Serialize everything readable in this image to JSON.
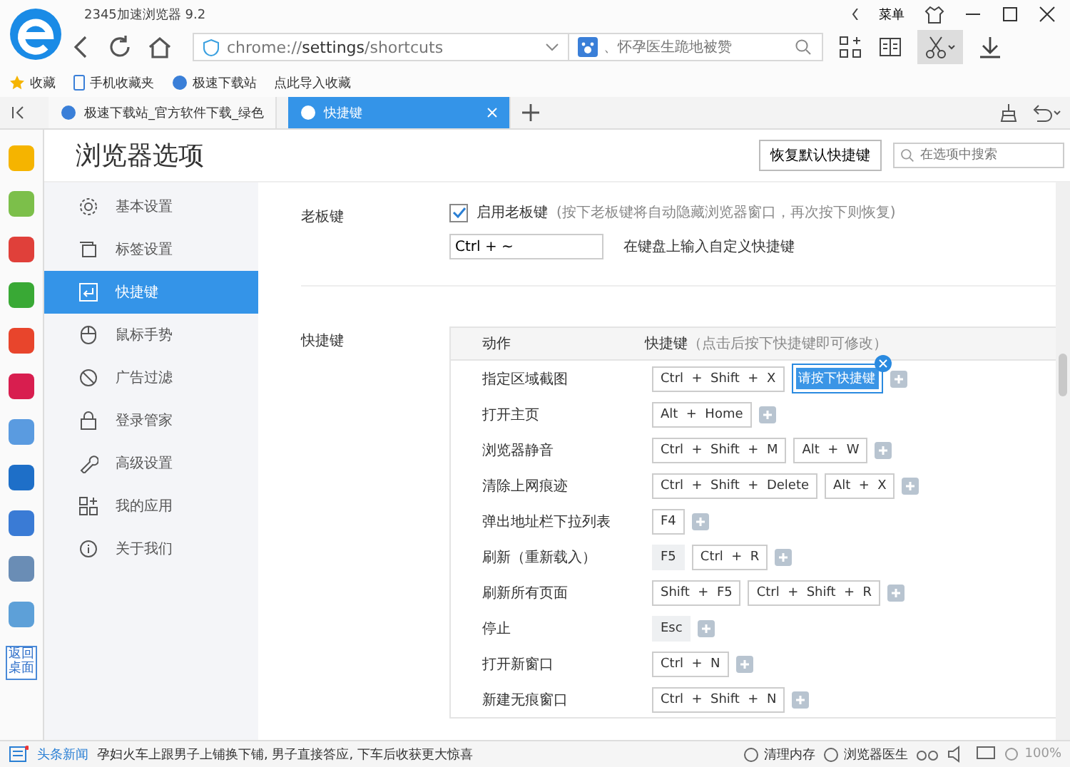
{
  "window": {
    "title": "2345加速浏览器 9.2",
    "menu": "菜单"
  },
  "address_bar": {
    "url": "chrome://**settings**/shortcuts",
    "search_placeholder": "、怀孕医生跪地被赞"
  },
  "bookmarks": [
    "收藏",
    "手机收藏夹",
    "极速下载站",
    "点此导入收藏"
  ],
  "tabs": [
    {
      "label": "极速下载站_官方软件下载_绿色",
      "selected": false
    },
    {
      "label": "快捷键",
      "selected": true
    }
  ],
  "side_panel": {
    "desktop_button": "返回桌面"
  },
  "page": {
    "title": "浏览器选项",
    "reset_button": "恢复默认快捷键",
    "search_placeholder": "在选项中搜索"
  },
  "nav": [
    {
      "label": "基本设置",
      "kind": "gear",
      "selected": false
    },
    {
      "label": "标签设置",
      "kind": "tabs",
      "selected": false
    },
    {
      "label": "快捷键",
      "kind": "enter",
      "selected": true
    },
    {
      "label": "鼠标手势",
      "kind": "mouse",
      "selected": false
    },
    {
      "label": "广告过滤",
      "kind": "block",
      "selected": false
    },
    {
      "label": "登录管家",
      "kind": "lock",
      "selected": false
    },
    {
      "label": "高级设置",
      "kind": "wrench",
      "selected": false
    },
    {
      "label": "我的应用",
      "kind": "apps",
      "selected": false
    },
    {
      "label": "关于我们",
      "kind": "info",
      "selected": false
    }
  ],
  "boss_key": {
    "label": "老板键",
    "checkbox_label": "启用老板键",
    "checked": true,
    "hint": "(按下老板键将自动隐藏浏览器窗口，再次按下则恢复)",
    "value": "Ctrl + ~",
    "note": "在键盘上输入自定义快捷键"
  },
  "shortcuts": {
    "label": "快捷键",
    "columns": [
      "动作",
      "快捷键"
    ],
    "column_hint": "（点击后按下快捷键即可修改）",
    "rows": [
      {
        "action": "指定区域截图",
        "keys": [
          {
            "text": "Ctrl  +  Shift  +  X",
            "kind": "editable"
          },
          {
            "text": "请按下快捷键",
            "kind": "recording"
          }
        ]
      },
      {
        "action": "打开主页",
        "keys": [
          {
            "text": "Alt  +  Home",
            "kind": "editable"
          }
        ]
      },
      {
        "action": "浏览器静音",
        "keys": [
          {
            "text": "Ctrl  +  Shift  +  M",
            "kind": "editable"
          },
          {
            "text": "Alt  +  W",
            "kind": "editable"
          }
        ]
      },
      {
        "action": "清除上网痕迹",
        "keys": [
          {
            "text": "Ctrl  +  Shift  +  Delete",
            "kind": "editable"
          },
          {
            "text": "Alt  +  X",
            "kind": "editable"
          }
        ]
      },
      {
        "action": "弹出地址栏下拉列表",
        "keys": [
          {
            "text": "F4",
            "kind": "editable"
          }
        ]
      },
      {
        "action": "刷新（重新载入）",
        "keys": [
          {
            "text": "F5",
            "kind": "fixed"
          },
          {
            "text": "Ctrl  +  R",
            "kind": "editable"
          }
        ]
      },
      {
        "action": "刷新所有页面",
        "keys": [
          {
            "text": "Shift  +  F5",
            "kind": "editable"
          },
          {
            "text": "Ctrl  +  Shift  +  R",
            "kind": "editable"
          }
        ]
      },
      {
        "action": "停止",
        "keys": [
          {
            "text": "Esc",
            "kind": "fixed"
          }
        ]
      },
      {
        "action": "打开新窗口",
        "keys": [
          {
            "text": "Ctrl  +  N",
            "kind": "editable"
          }
        ]
      },
      {
        "action": "新建无痕窗口",
        "keys": [
          {
            "text": "Ctrl  +  Shift  +  N",
            "kind": "editable"
          }
        ]
      }
    ]
  },
  "status_bar": {
    "news_label": "头条新闻",
    "headline": "孕妇火车上跟男子上铺换下铺, 男子直接答应, 下车后收获更大惊喜",
    "tools": [
      "清理内存",
      "浏览器医生"
    ],
    "zoom": "100%"
  }
}
